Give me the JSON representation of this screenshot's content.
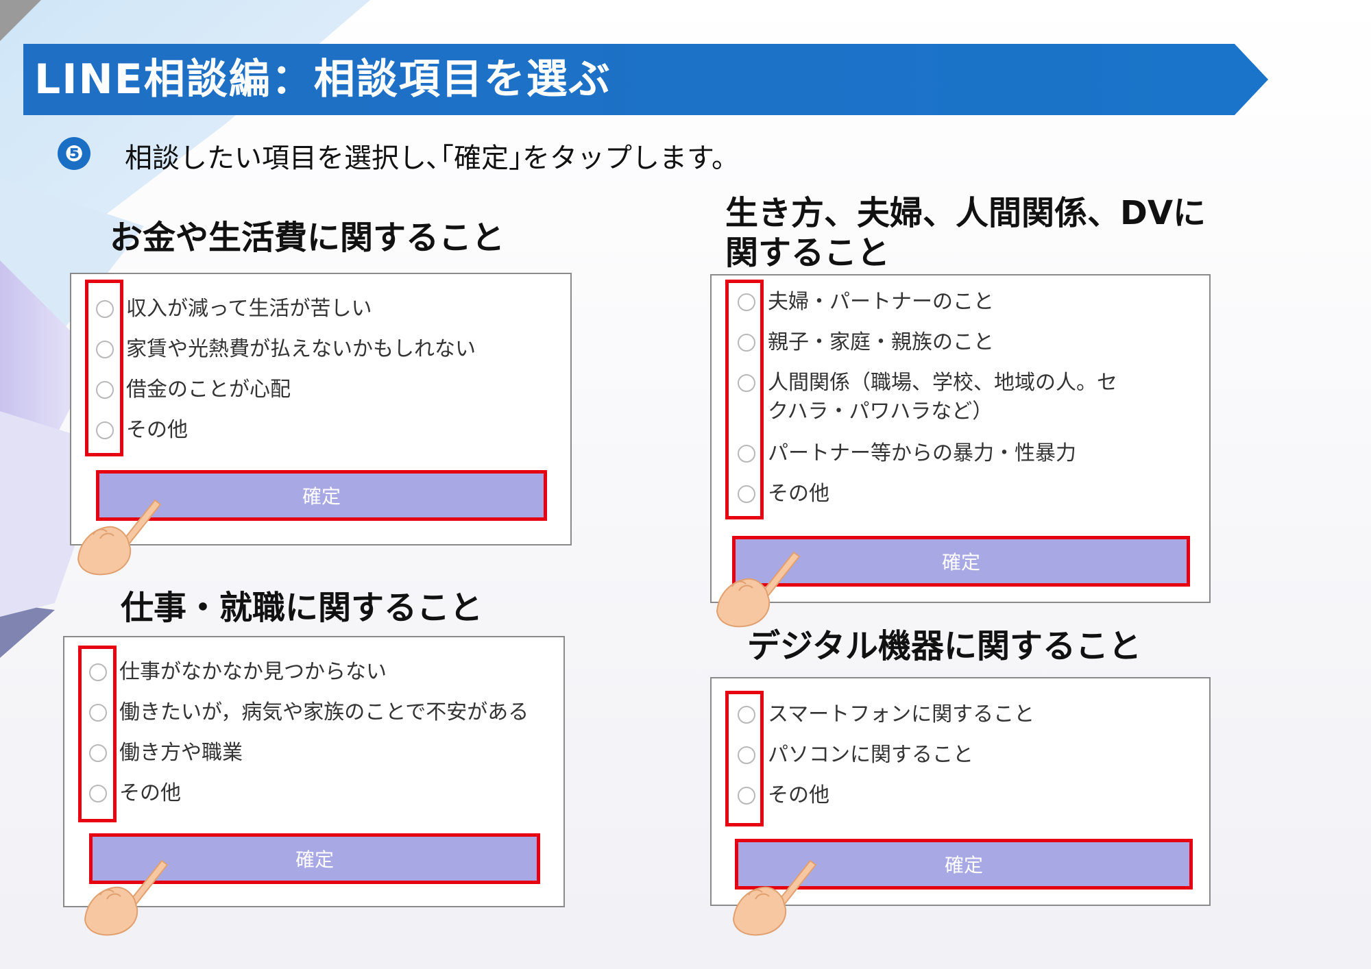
{
  "header": {
    "title": "LINE相談編：相談項目を選ぶ"
  },
  "step": {
    "number": "❺",
    "instruction": "相談したい項目を選択し､｢確定｣をタップします。"
  },
  "sections": [
    {
      "title": "お金や生活費に関すること",
      "options": [
        "収入が減って生活が苦しい",
        "家賃や光熱費が払えないかもしれない",
        "借金のことが心配",
        "その他"
      ],
      "confirm_label": "確定"
    },
    {
      "title_lines": [
        "生き方、夫婦、人間関係、DVに",
        "関すること"
      ],
      "options": [
        "夫婦・パートナーのこと",
        "親子・家庭・親族のこと",
        "人間関係（職場、学校、地域の人。セクハラ・パワハラなど）",
        "パートナー等からの暴力・性暴力",
        "その他"
      ],
      "confirm_label": "確定"
    },
    {
      "title": "仕事・就職に関すること",
      "options": [
        "仕事がなかなか見つからない",
        "働きたいが，病気や家族のことで不安がある",
        "働き方や職業",
        "その他"
      ],
      "confirm_label": "確定"
    },
    {
      "title": "デジタル機器に関すること",
      "options": [
        "スマートフォンに関すること",
        "パソコンに関すること",
        "その他"
      ],
      "confirm_label": "確定"
    }
  ],
  "colors": {
    "banner": "#1a74c9",
    "button": "#a8a8e4",
    "highlight": "#e60012"
  },
  "icons": [
    "pointing-hand-icon",
    "radio-icon"
  ]
}
